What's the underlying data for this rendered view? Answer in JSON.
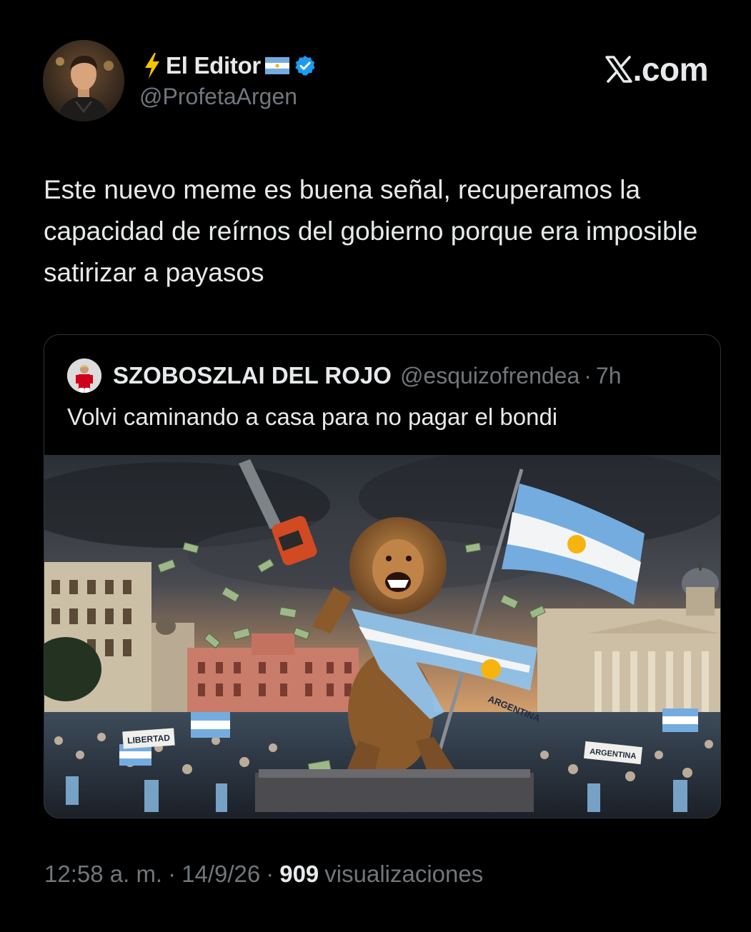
{
  "author": {
    "display_name": "El Editor",
    "handle": "@ProfetaArgen",
    "bolt_icon": "lightning-bolt-icon",
    "flag_icon": "argentina-flag-icon",
    "verified_icon": "verified-badge-icon",
    "verified_color": "#1d9bf0"
  },
  "brand": {
    "label": ".com",
    "logo_icon": "x-logo-icon"
  },
  "tweet": {
    "text": "Este nuevo meme es buena señal, recuperamos la capacidad de reírnos del gobierno porque era imposible satirizar a payasos"
  },
  "quote": {
    "name": "SZOBOSZLAI DEL ROJO",
    "handle": "@esquizofrendea",
    "dot": "·",
    "time": "7h",
    "text": "Volvi caminando a casa para no pagar el bondi",
    "image_labels": {
      "sign_left": "LIBERTAD",
      "sign_right": "ARGENTINA",
      "sash": "ARGENTINA"
    }
  },
  "meta": {
    "time": "12:58 a. m.",
    "sep1": "·",
    "date": "14/9/26",
    "sep2": "·",
    "views_count": "909",
    "views_label": "visualizaciones"
  },
  "colors": {
    "background": "#000000",
    "text_primary": "#e7e9ea",
    "text_secondary": "#71767b",
    "border": "#2f3336",
    "flag_blue": "#74acdf"
  }
}
